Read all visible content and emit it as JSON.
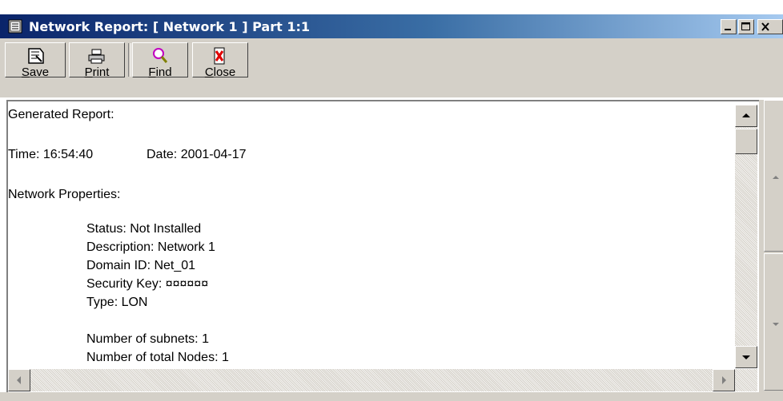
{
  "window": {
    "title": "Network Report: [ Network 1 ] Part 1:1",
    "minimize_icon": "minimize-icon",
    "maximize_icon": "maximize-icon",
    "close_icon": "close-icon"
  },
  "toolbar": {
    "buttons": [
      {
        "label_first": "S",
        "label_rest": "ave",
        "icon": "save-icon"
      },
      {
        "label_first": "P",
        "label_rest": "rint",
        "icon": "print-icon"
      },
      {
        "label_first": "F",
        "label_rest": "ind",
        "icon": "find-icon"
      },
      {
        "label_first": "C",
        "label_rest": "lose",
        "icon": "close-report-icon"
      }
    ]
  },
  "report": {
    "heading": "Generated Report:",
    "time": "Time: 16:54:40",
    "date": "Date: 2001-04-17",
    "section": "Network Properties:",
    "status": "Status: Not Installed",
    "description": "Description: Network 1",
    "domain_id": "Domain ID: Net_01",
    "security_key": "Security Key: ¤¤¤¤¤¤",
    "type": "Type: LON",
    "subnets": "Number of subnets: 1",
    "total_nodes": "Number of total Nodes: 1"
  }
}
